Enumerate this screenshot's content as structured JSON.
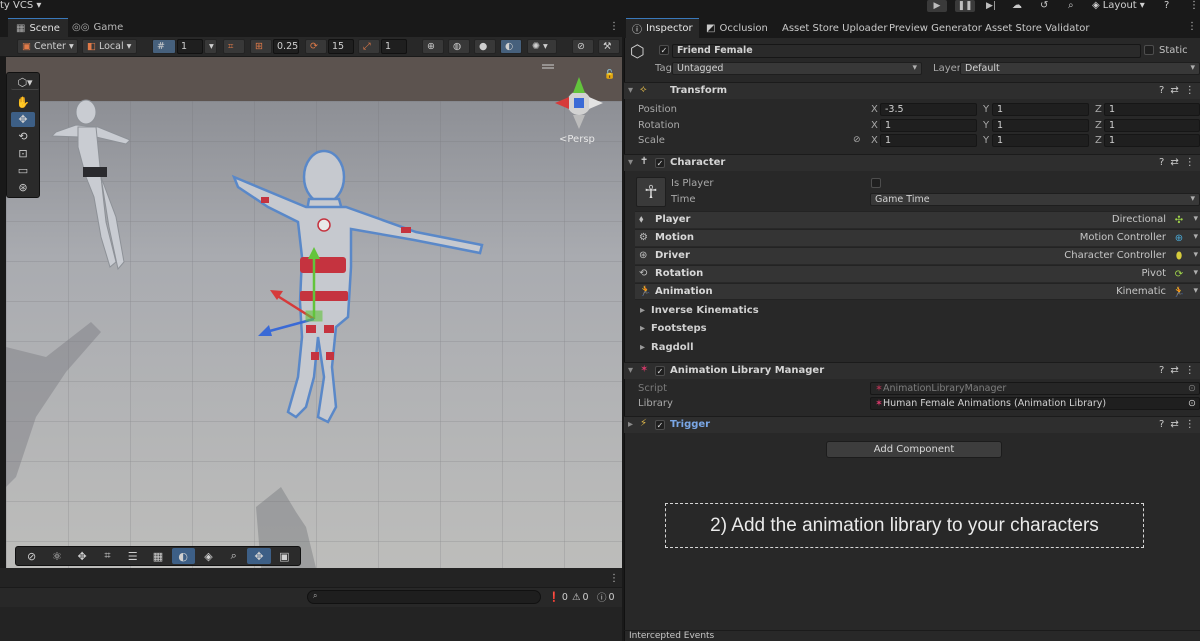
{
  "topbar": {
    "vcs_label": "ty VCS",
    "layout_label": "Layout"
  },
  "scene": {
    "tabs": [
      {
        "label": "Scene"
      },
      {
        "label": "Game"
      }
    ],
    "pivot_label": "Center",
    "space_label": "Local",
    "grid_value": "1",
    "snap_increment": "0.25",
    "rotate_snap": "15",
    "scale_snap": "1",
    "persp_label": "<Persp",
    "console": {
      "errors": "0",
      "warnings": "0",
      "messages": "0"
    }
  },
  "inspector": {
    "tabs": [
      {
        "label": "Inspector"
      },
      {
        "label": "Occlusion"
      },
      {
        "label": "Asset Store Uploader"
      },
      {
        "label": "Preview Generator"
      },
      {
        "label": "Asset Store Validator"
      }
    ],
    "object_name": "Friend Female",
    "static_label": "Static",
    "tag_label": "Tag",
    "tag_value": "Untagged",
    "layer_label": "Layer",
    "layer_value": "Default",
    "transform": {
      "title": "Transform",
      "position_label": "Position",
      "rotation_label": "Rotation",
      "scale_label": "Scale",
      "position": {
        "x": "-3.5",
        "y": "1",
        "z": "1"
      },
      "rotation": {
        "x": "1",
        "y": "1",
        "z": "1"
      },
      "scale": {
        "x": "1",
        "y": "1",
        "z": "1"
      },
      "x_label": "X",
      "y_label": "Y",
      "z_label": "Z"
    },
    "character": {
      "title": "Character",
      "is_player_label": "Is Player",
      "time_label": "Time",
      "time_value": "Game Time",
      "modules": [
        {
          "name": "Player",
          "value": "Directional",
          "color": "#9fd34a"
        },
        {
          "name": "Motion",
          "value": "Motion Controller",
          "color": "#4aa9d6"
        },
        {
          "name": "Driver",
          "value": "Character Controller",
          "color": "#d6cc3c"
        },
        {
          "name": "Rotation",
          "value": "Pivot",
          "color": "#9fd34a"
        },
        {
          "name": "Animation",
          "value": "Kinematic",
          "color": "#9fd34a"
        }
      ],
      "foldouts": [
        {
          "label": "Inverse Kinematics"
        },
        {
          "label": "Footsteps"
        },
        {
          "label": "Ragdoll"
        }
      ]
    },
    "anim_library_manager": {
      "title": "Animation Library Manager",
      "script_label": "Script",
      "script_value": "AnimationLibraryManager",
      "library_label": "Library",
      "library_value": "Human Female Animations (Animation Library)"
    },
    "trigger": {
      "title": "Trigger"
    },
    "add_component_label": "Add Component",
    "caption": "2) Add the animation library to your characters",
    "events_label": "Intercepted Events"
  },
  "colors": {
    "accent": "#3a79bb",
    "tool_active": "#3d5f86",
    "module_green": "#9fd34a",
    "module_blue": "#4aa9d6",
    "module_yellow": "#d6cc3c"
  }
}
